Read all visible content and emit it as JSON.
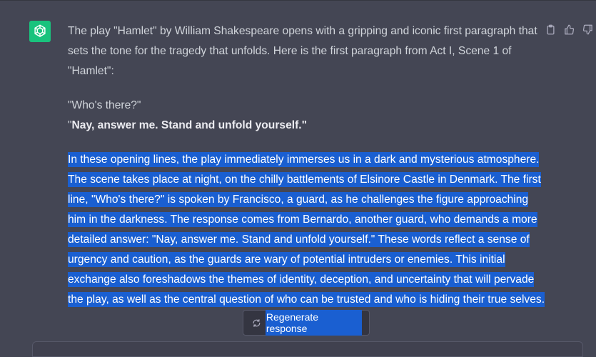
{
  "message": {
    "intro": "The play \"Hamlet\" by William Shakespeare opens with a gripping and iconic first paragraph that sets the tone for the tragedy that unfolds. Here is the first paragraph from Act I, Scene 1 of \"Hamlet\":",
    "quote_line_1": "\"Who's there?\"",
    "quote_line_2_open": "\"",
    "quote_line_2_bold": "Nay, answer me. Stand and unfold yourself.",
    "quote_line_2_close": "\"",
    "analysis": "In these opening lines, the play immediately immerses us in a dark and mysterious atmosphere. The scene takes place at night, on the chilly battlements of Elsinore Castle in Denmark. The first line, \"Who's there?\" is spoken by Francisco, a guard, as he challenges the figure approaching him in the darkness. The response comes from Bernardo, another guard, who demands a more detailed answer: \"Nay, answer me. Stand and unfold yourself.\" These words reflect a sense of urgency and caution, as the guards are wary of potential intruders or enemies. This initial exchange also foreshadows the themes of identity, deception, and uncertainty that will pervade the play, as well as the central question of who can be trusted and who is hiding their true selves."
  },
  "actions": {
    "copy_icon": "clipboard-icon",
    "like_icon": "thumbs-up-icon",
    "dislike_icon": "thumbs-down-icon"
  },
  "regenerate": {
    "label": "Regenerate response",
    "icon": "refresh-icon"
  },
  "colors": {
    "background": "#444654",
    "avatar": "#19c37d",
    "selection": "#1a5fd1"
  }
}
